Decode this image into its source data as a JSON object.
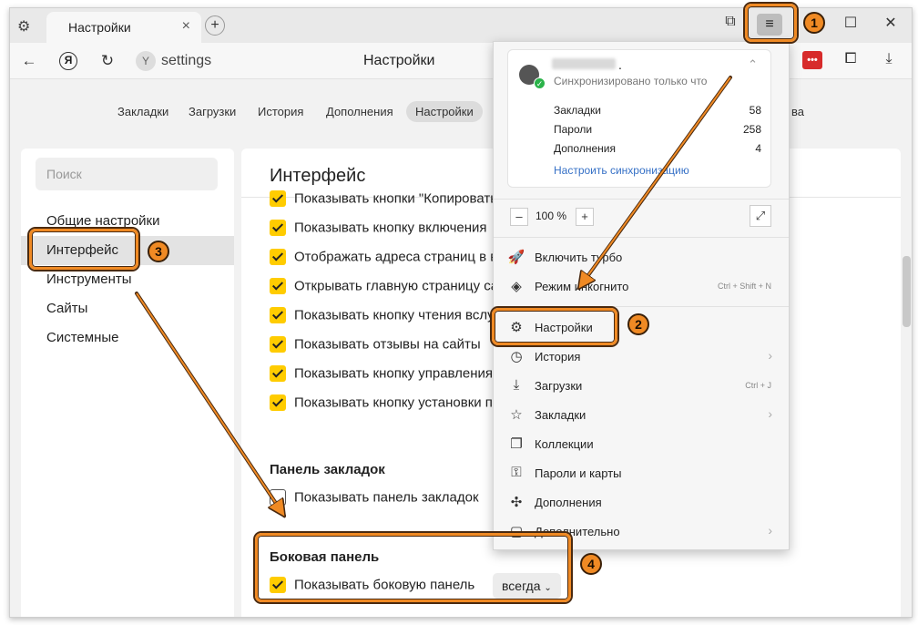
{
  "browser": {
    "tab_title": "Настройки",
    "url_text": "settings",
    "address_title": "Настройки",
    "ya_letter": "Я",
    "ext_badge": "•••"
  },
  "settings_nav": {
    "items": [
      "Закладки",
      "Загрузки",
      "История",
      "Дополнения",
      "Настройки",
      "ва"
    ]
  },
  "sidebar": {
    "search_placeholder": "Поиск",
    "items": [
      "Общие настройки",
      "Интерфейс",
      "Инструменты",
      "Сайты",
      "Системные"
    ],
    "active_index": 1
  },
  "content": {
    "title": "Интерфейс",
    "interface_options": [
      "Показывать кнопки \"Копировать\"",
      "Показывать кнопку включения",
      "Отображать адреса страниц в в",
      "Открывать главную страницу са",
      "Показывать кнопку чтения вслу",
      "Показывать отзывы на сайты",
      "Показывать кнопку управления",
      "Показывать кнопку установки п"
    ],
    "bookmarks_section": {
      "title": "Панель закладок",
      "option_label": "Показывать панель закладок",
      "checked": false
    },
    "sidebar_section": {
      "title": "Боковая панель",
      "option_label": "Показывать боковую панель",
      "checked": true,
      "dropdown_value": "всегда"
    }
  },
  "menu": {
    "sync": {
      "account_suffix": ".",
      "status": "Синхронизировано только что",
      "stats": [
        {
          "label": "Закладки",
          "value": "58"
        },
        {
          "label": "Пароли",
          "value": "258"
        },
        {
          "label": "Дополнения",
          "value": "4"
        }
      ],
      "link": "Настроить синхронизацию"
    },
    "zoom": {
      "minus": "–",
      "value": "100 %",
      "plus": "+"
    },
    "items": [
      {
        "label": "Включить турбо",
        "hint": "",
        "arrow": false
      },
      {
        "label": "Режим инкогнито",
        "hint": "Ctrl + Shift + N",
        "arrow": false
      },
      {
        "label": "Настройки",
        "hint": "",
        "arrow": false
      },
      {
        "label": "История",
        "hint": "",
        "arrow": true
      },
      {
        "label": "Загрузки",
        "hint": "Ctrl + J",
        "arrow": false
      },
      {
        "label": "Закладки",
        "hint": "",
        "arrow": true
      },
      {
        "label": "Коллекции",
        "hint": "",
        "arrow": false
      },
      {
        "label": "Пароли и карты",
        "hint": "",
        "arrow": false
      },
      {
        "label": "Дополнения",
        "hint": "",
        "arrow": false
      },
      {
        "label": "Дополнительно",
        "hint": "",
        "arrow": true
      }
    ]
  },
  "callouts": {
    "step1": "1",
    "step2": "2",
    "step3": "3",
    "step4": "4"
  },
  "colors": {
    "accent_yellow": "#ffcc00",
    "callout_orange": "#f08a24",
    "sync_green": "#2bb34a",
    "link_blue": "#3570c6",
    "ext_red": "#d72b2b"
  }
}
